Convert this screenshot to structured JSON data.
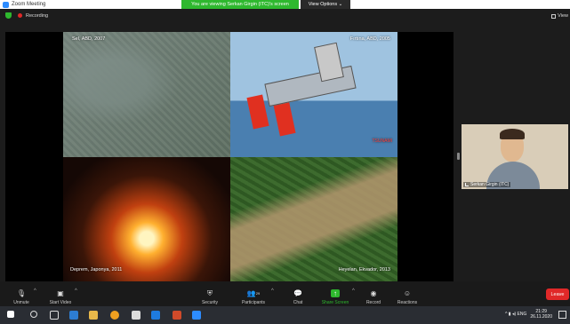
{
  "window": {
    "title": "Zoom Meeting",
    "controls": [
      "–",
      "▢",
      "✕"
    ]
  },
  "banner": {
    "sharing_text": "You are viewing Serkan Girgin (ITC)'s screen",
    "view_options": "View Options ⌄"
  },
  "meeting": {
    "recording_label": "Recording",
    "view_label": "View"
  },
  "slide": {
    "captions": [
      "Sel, ABD, 2007",
      "Fırtına, ABD, 2005",
      "Deprem, Japonya, 2011",
      "Heyelan, Ekvador, 2013"
    ],
    "credit": "TSUNAMI"
  },
  "participant": {
    "name": "Serkan Girgin (ITC)"
  },
  "toolbar": {
    "items": [
      {
        "label": "Unmute",
        "icon": "microphone-muted-icon"
      },
      {
        "label": "Start Video",
        "icon": "video-off-icon"
      },
      {
        "label": "Security",
        "icon": "shield-icon"
      },
      {
        "label": "Participants",
        "icon": "people-icon",
        "count": "29"
      },
      {
        "label": "Chat",
        "icon": "chat-icon"
      },
      {
        "label": "Share Screen",
        "icon": "share-screen-icon"
      },
      {
        "label": "Record",
        "icon": "record-icon"
      },
      {
        "label": "Reactions",
        "icon": "reactions-icon"
      }
    ],
    "leave_label": "Leave"
  },
  "taskbar": {
    "time": "21:29",
    "date": "26.11.2020",
    "tray_text": "^ ▮ ◂) ENG"
  },
  "colors": {
    "accent_green": "#2eb82e",
    "leave_red": "#e02828",
    "zoom_blue": "#2d8cff"
  }
}
